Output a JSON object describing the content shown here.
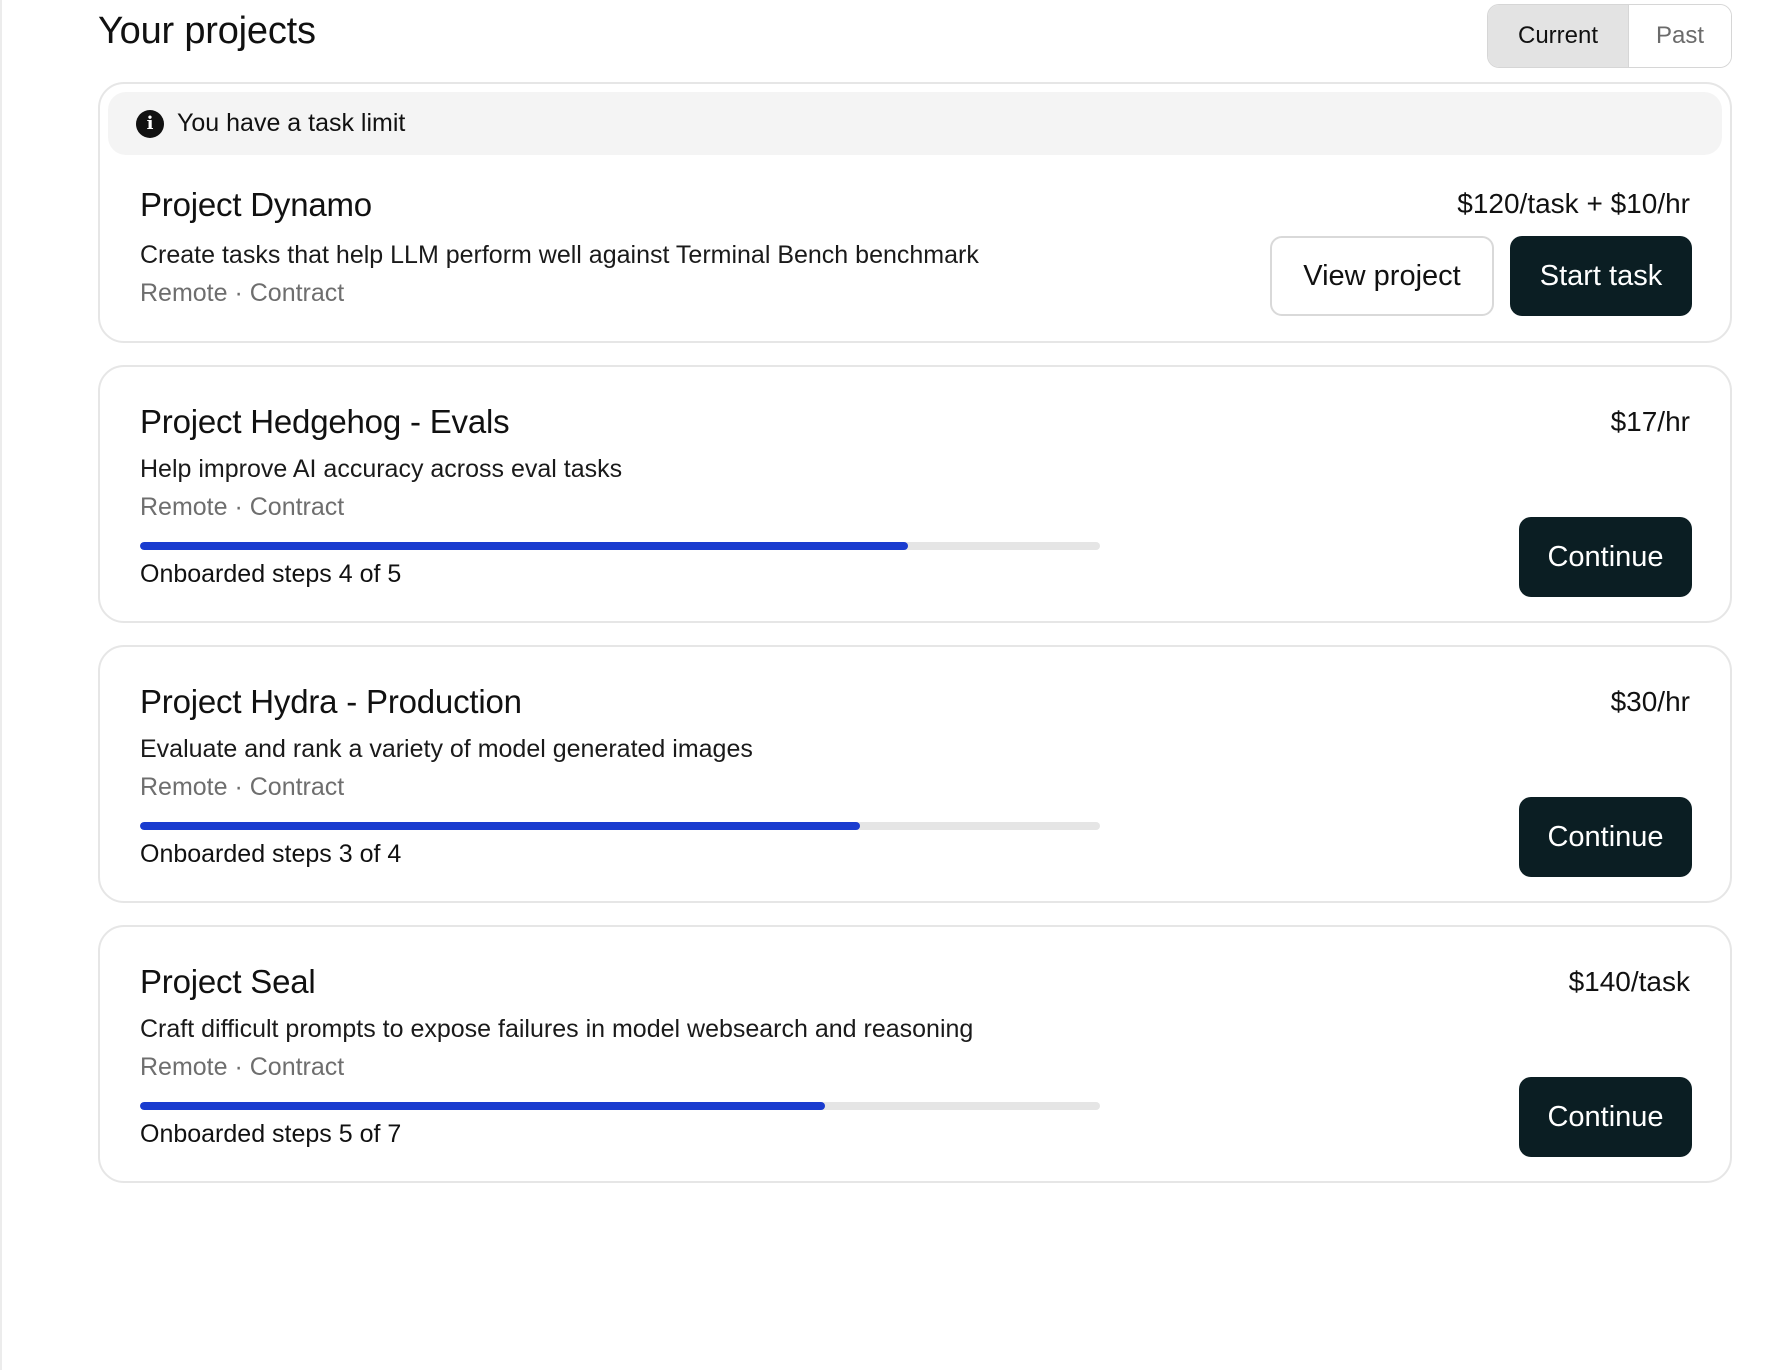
{
  "header": {
    "title": "Your projects",
    "tabs": [
      {
        "label": "Current",
        "active": true
      },
      {
        "label": "Past",
        "active": false
      }
    ]
  },
  "projects": [
    {
      "notice": "You have a task limit",
      "name": "Project Dynamo",
      "rate": "$120/task + $10/hr",
      "description": "Create tasks that help LLM perform well against Terminal Bench benchmark",
      "meta": "Remote · Contract",
      "secondary_button": "View project",
      "primary_button": "Start task"
    },
    {
      "name": "Project Hedgehog - Evals",
      "rate": "$17/hr",
      "description": "Help improve AI accuracy across eval tasks",
      "meta": "Remote · Contract",
      "progress": 0.8,
      "progress_label": "Onboarded steps 4 of 5",
      "primary_button": "Continue"
    },
    {
      "name": "Project Hydra - Production",
      "rate": "$30/hr",
      "description": "Evaluate and rank a variety of model generated images",
      "meta": "Remote · Contract",
      "progress": 0.75,
      "progress_label": "Onboarded steps 3 of 4",
      "primary_button": "Continue"
    },
    {
      "name": "Project Seal",
      "rate": "$140/task",
      "description": "Craft difficult prompts to expose failures in model websearch and reasoning",
      "meta": "Remote · Contract",
      "progress": 0.714,
      "progress_label": "Onboarded steps 5 of 7",
      "primary_button": "Continue"
    }
  ],
  "colors": {
    "accent": "#1a3ccf",
    "button_dark": "#0b1e23",
    "track": "#e5e5e5"
  },
  "icons": {
    "notice": "info-icon"
  }
}
